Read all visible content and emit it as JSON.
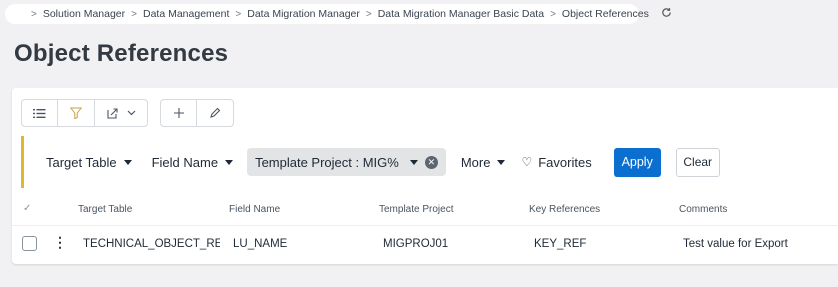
{
  "breadcrumb": {
    "items": [
      "Solution Manager",
      "Data Management",
      "Data Migration Manager",
      "Data Migration Manager Basic Data",
      "Object References"
    ],
    "separator": ">",
    "refresh_icon": "refresh-icon"
  },
  "page": {
    "title": "Object References"
  },
  "toolbar": {
    "icons": [
      "list-view-icon",
      "filter-icon",
      "export-icon",
      "chevron-down-icon",
      "plus-icon",
      "pencil-icon"
    ]
  },
  "filters": {
    "target_table": "Target Table",
    "field_name": "Field Name",
    "template_project_chip": "Template Project : MIG%",
    "more": "More",
    "favorites": "Favorites",
    "apply": "Apply",
    "clear": "Clear",
    "accent_color": "#e1b82d"
  },
  "table": {
    "select_all_icon": "check-icon",
    "columns": [
      "Target Table",
      "Field Name",
      "Template Project",
      "Key References",
      "Comments"
    ],
    "rows": [
      {
        "target_table": "TECHNICAL_OBJECT_REFE",
        "field_name": "LU_NAME",
        "template_project": "MIGPROJ01",
        "key_references": "KEY_REF",
        "comments": "Test value for Export"
      }
    ]
  },
  "colors": {
    "primary": "#0b6fd0",
    "background": "#f1f1f3",
    "card": "#ffffff"
  }
}
